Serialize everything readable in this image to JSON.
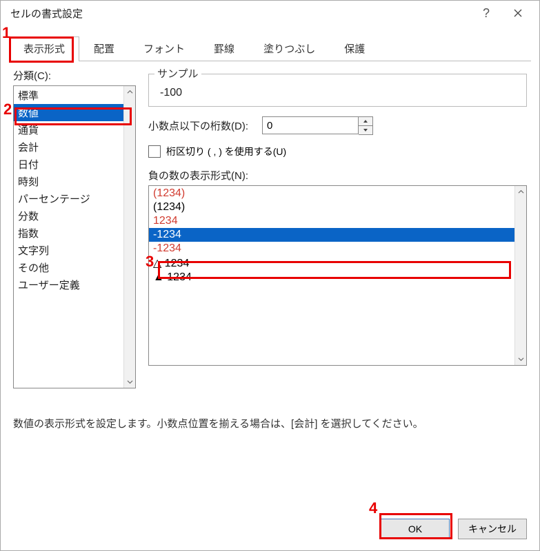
{
  "window": {
    "title": "セルの書式設定",
    "help": "?",
    "close": "×"
  },
  "tabs": [
    {
      "label": "表示形式",
      "active": true
    },
    {
      "label": "配置"
    },
    {
      "label": "フォント"
    },
    {
      "label": "罫線"
    },
    {
      "label": "塗りつぶし"
    },
    {
      "label": "保護"
    }
  ],
  "category": {
    "label": "分類(C):",
    "items": [
      "標準",
      "数値",
      "通貨",
      "会計",
      "日付",
      "時刻",
      "パーセンテージ",
      "分数",
      "指数",
      "文字列",
      "その他",
      "ユーザー定義"
    ],
    "selected_index": 1
  },
  "sample": {
    "legend": "サンプル",
    "value": "-100"
  },
  "decimals": {
    "label": "小数点以下の桁数(D):",
    "value": "0"
  },
  "thousands": {
    "label": "桁区切り ( , ) を使用する(U)",
    "checked": false
  },
  "negative": {
    "label": "負の数の表示形式(N):",
    "items": [
      {
        "text": "(1234)",
        "red": true
      },
      {
        "text": "(1234)",
        "red": false
      },
      {
        "text": "1234",
        "red": true
      },
      {
        "text": "-1234",
        "red": false,
        "selected": true
      },
      {
        "text": "-1234",
        "red": true
      },
      {
        "text": "△ 1234",
        "red": false
      },
      {
        "text": "▲ 1234",
        "red": false
      }
    ]
  },
  "description": "数値の表示形式を設定します。小数点位置を揃える場合は、[会計] を選択してください。",
  "buttons": {
    "ok": "OK",
    "cancel": "キャンセル"
  },
  "annotations": {
    "n1": "1",
    "n2": "2",
    "n3": "3",
    "n4": "4"
  }
}
